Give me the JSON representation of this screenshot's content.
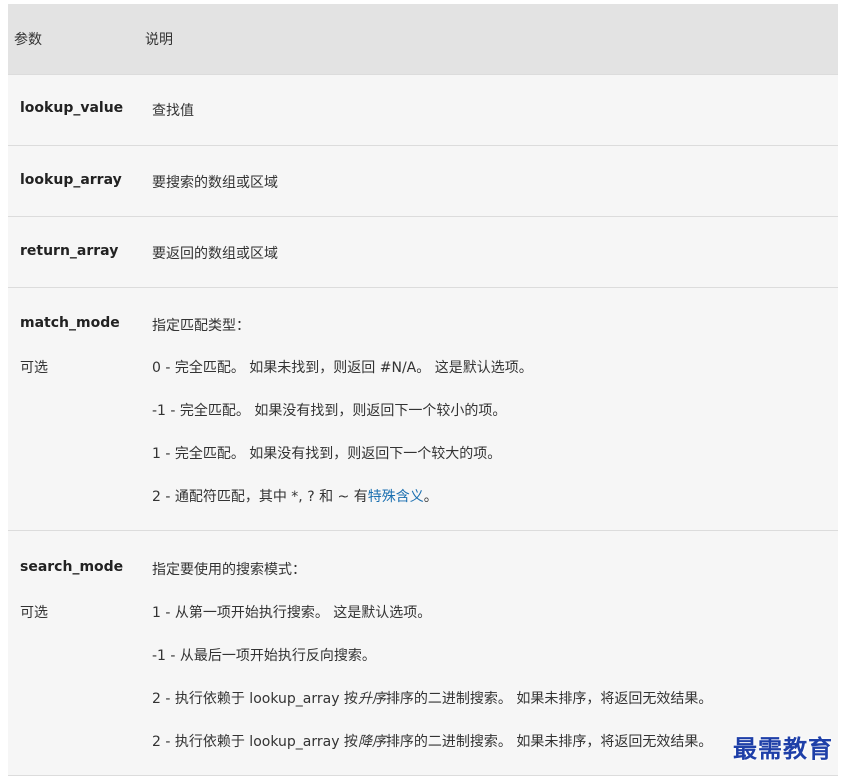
{
  "header": {
    "param": "参数",
    "desc": "说明"
  },
  "rows": {
    "lookup_value": {
      "param": "lookup_value",
      "desc": "查找值"
    },
    "lookup_array": {
      "param": "lookup_array",
      "desc": "要搜索的数组或区域"
    },
    "return_array": {
      "param": "return_array",
      "desc": "要返回的数组或区域"
    },
    "match_mode": {
      "param": "match_mode",
      "optional": "可选",
      "title": "指定匹配类型：",
      "items": [
        "0 - 完全匹配。 如果未找到，则返回 #N/A。 这是默认选项。",
        "-1 - 完全匹配。 如果没有找到，则返回下一个较小的项。",
        "1 - 完全匹配。 如果没有找到，则返回下一个较大的项。"
      ],
      "wildcard_prefix": "2 - 通配符匹配，其中 *, ? 和 ~ 有",
      "wildcard_link": "特殊含义",
      "wildcard_suffix": "。"
    },
    "search_mode": {
      "param": "search_mode",
      "optional": "可选",
      "title": "指定要使用的搜索模式：",
      "items": [
        "1 - 从第一项开始执行搜索。 这是默认选项。",
        "-1 - 从最后一项开始执行反向搜索。"
      ],
      "binary_asc_prefix": "2 - 执行依赖于 lookup_array 按",
      "binary_asc_em": "升序",
      "binary_asc_suffix": "排序的二进制搜索。 如果未排序，将返回无效结果。",
      "binary_desc_prefix": "2 - 执行依赖于 lookup_array 按",
      "binary_desc_em": "降序",
      "binary_desc_suffix": "排序的二进制搜索。 如果未排序，将返回无效结果。"
    }
  },
  "watermark": "最需教育"
}
